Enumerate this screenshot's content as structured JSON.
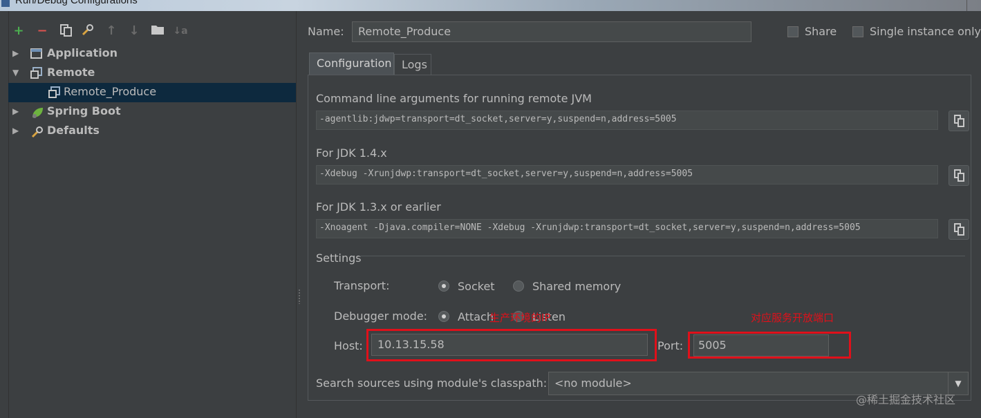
{
  "window": {
    "title": "Run/Debug Configurations"
  },
  "toolbar": {
    "add": "+",
    "remove": "−",
    "copy_icon": "copy-icon",
    "edit_defaults_icon": "wrench-icon",
    "move_up": "↑",
    "move_down": "↓",
    "folder_icon": "folder-icon",
    "sort": "↓a"
  },
  "tree": {
    "items": [
      {
        "label": "Application",
        "icon": "application-icon",
        "expanded": false
      },
      {
        "label": "Remote",
        "icon": "remote-icon",
        "expanded": true
      },
      {
        "label": "Remote_Produce",
        "icon": "remote-icon",
        "selected": true
      },
      {
        "label": "Spring Boot",
        "icon": "spring-boot-icon",
        "expanded": false
      },
      {
        "label": "Defaults",
        "icon": "wrench-icon",
        "expanded": false
      }
    ]
  },
  "name": {
    "label": "Name:",
    "value": "Remote_Produce"
  },
  "share": {
    "label": "Share",
    "checked": false
  },
  "single_instance": {
    "label": "Single instance only",
    "checked": false
  },
  "tabs": [
    {
      "label": "Configuration",
      "active": true
    },
    {
      "label": "Logs",
      "active": false
    }
  ],
  "config": {
    "cmd_label": "Command line arguments for running remote JVM",
    "cmd_value": "-agentlib:jdwp=transport=dt_socket,server=y,suspend=n,address=5005",
    "jdk14_label": "For JDK 1.4.x",
    "jdk14_value": "-Xdebug -Xrunjdwp:transport=dt_socket,server=y,suspend=n,address=5005",
    "jdk13_label": "For JDK 1.3.x or earlier",
    "jdk13_value": "-Xnoagent -Djava.compiler=NONE -Xdebug -Xrunjdwp:transport=dt_socket,server=y,suspend=n,address=5005"
  },
  "settings": {
    "title": "Settings",
    "transport_label": "Transport:",
    "transport_socket": "Socket",
    "transport_shared": "Shared memory",
    "debugger_label": "Debugger mode:",
    "debugger_attach": "Attach",
    "debugger_listen": "Listen",
    "host_label": "Host:",
    "host_value": "10.13.15.58",
    "port_label": "Port:",
    "port_value": "5005",
    "module_label": "Search sources using module's classpath:",
    "module_value": "<no module>"
  },
  "annotations": {
    "host_note": "生产环境的IP",
    "port_note": "对应服务开放端口"
  },
  "watermark": "@稀土掘金技术社区",
  "colors": {
    "background": "#3c3f41",
    "selection": "#0d293e",
    "annotation_red": "#e0101a",
    "add_green": "#4caf50",
    "remove_red": "#d9534f"
  }
}
